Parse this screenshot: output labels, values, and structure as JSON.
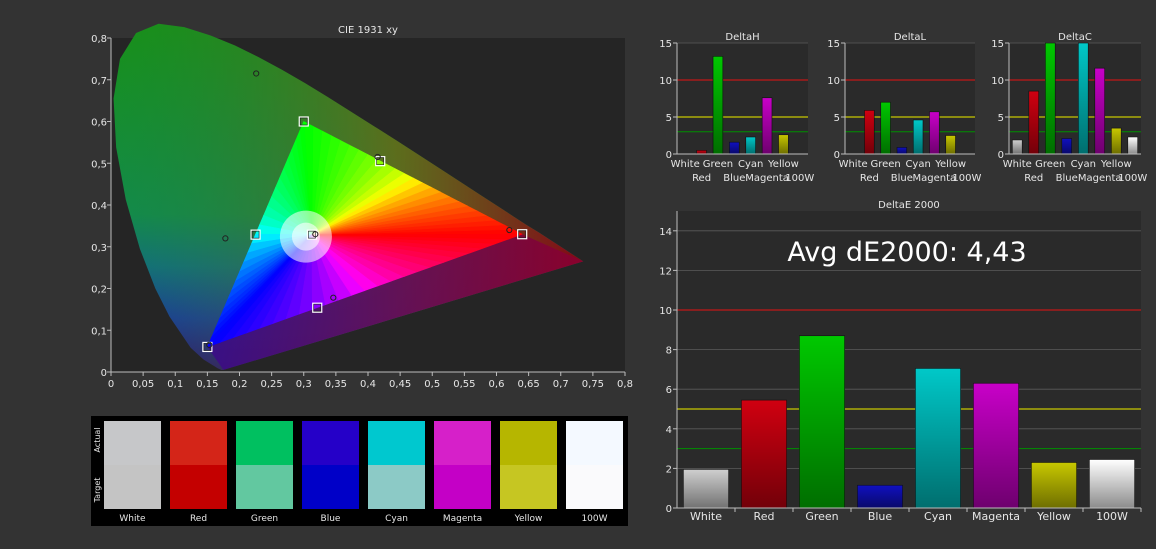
{
  "chart_data": [
    {
      "type": "scatter",
      "title": "CIE 1931 xy",
      "xlim": [
        0,
        0.8
      ],
      "ylim": [
        0,
        0.8
      ],
      "x_ticks": [
        "0",
        "0,05",
        "0,1",
        "0,15",
        "0,2",
        "0,25",
        "0,3",
        "0,35",
        "0,4",
        "0,45",
        "0,5",
        "0,55",
        "0,6",
        "0,65",
        "0,7",
        "0,75",
        "0,8"
      ],
      "y_ticks": [
        "0",
        "0,1",
        "0,2",
        "0,3",
        "0,4",
        "0,5",
        "0,6",
        "0,7",
        "0,8"
      ],
      "series": [
        {
          "values": [
            [
              0.64,
              0.33
            ],
            [
              0.3,
              0.6
            ],
            [
              0.15,
              0.06
            ],
            [
              0.225,
              0.329
            ],
            [
              0.321,
              0.154
            ],
            [
              0.419,
              0.505
            ],
            [
              0.3127,
              0.329
            ]
          ]
        },
        {
          "values": [
            [
              0.62,
              0.34
            ],
            [
              0.226,
              0.715
            ],
            [
              0.153,
              0.065
            ],
            [
              0.178,
              0.32
            ],
            [
              0.346,
              0.178
            ],
            [
              0.415,
              0.515
            ],
            [
              0.318,
              0.33
            ]
          ]
        }
      ]
    },
    {
      "type": "bar",
      "title": "DeltaH",
      "categories": [
        "White",
        "Red",
        "Green",
        "Blue",
        "Cyan",
        "Magenta",
        "Yellow",
        "100W"
      ],
      "values": [
        0,
        0.5,
        13.2,
        1.6,
        2.3,
        7.6,
        2.6,
        0
      ],
      "ylim": [
        0,
        15
      ],
      "y_ticks": [
        "0",
        "5",
        "10",
        "15"
      ]
    },
    {
      "type": "bar",
      "title": "DeltaL",
      "categories": [
        "White",
        "Red",
        "Green",
        "Blue",
        "Cyan",
        "Magenta",
        "Yellow",
        "100W"
      ],
      "values": [
        0,
        5.9,
        7.0,
        0.9,
        4.6,
        5.7,
        2.5,
        0
      ],
      "ylim": [
        0,
        15
      ],
      "y_ticks": [
        "0",
        "5",
        "10",
        "15"
      ]
    },
    {
      "type": "bar",
      "title": "DeltaC",
      "categories": [
        "White",
        "Red",
        "Green",
        "Blue",
        "Cyan",
        "Magenta",
        "Yellow",
        "100W"
      ],
      "values": [
        1.9,
        8.5,
        15,
        2.1,
        15,
        11.6,
        3.5,
        2.3
      ],
      "ylim": [
        0,
        15
      ],
      "y_ticks": [
        "0",
        "5",
        "10",
        "15"
      ]
    },
    {
      "type": "bar",
      "title": "DeltaE 2000",
      "annotation": "Avg dE2000: 4,43",
      "categories": [
        "White",
        "Red",
        "Green",
        "Blue",
        "Cyan",
        "Magenta",
        "Yellow",
        "100W"
      ],
      "values": [
        1.95,
        5.45,
        8.7,
        1.15,
        7.05,
        6.3,
        2.3,
        2.45
      ],
      "ylim": [
        0,
        15
      ],
      "y_ticks": [
        "0",
        "2",
        "4",
        "6",
        "8",
        "10",
        "12",
        "14"
      ]
    }
  ],
  "swatches": {
    "side_labels": [
      "Actual",
      "Target"
    ],
    "items": [
      {
        "label": "White",
        "actual": "#c6c7c9",
        "target": "#c4c4c4"
      },
      {
        "label": "Red",
        "actual": "#d42518",
        "target": "#c40000"
      },
      {
        "label": "Green",
        "actual": "#00c060",
        "target": "#62c8a0"
      },
      {
        "label": "Blue",
        "actual": "#2500c8",
        "target": "#0000c8"
      },
      {
        "label": "Cyan",
        "actual": "#00c8cf",
        "target": "#8ccac6"
      },
      {
        "label": "Magenta",
        "actual": "#d620c9",
        "target": "#c400c6"
      },
      {
        "label": "Yellow",
        "actual": "#b6b600",
        "target": "#c6c622"
      },
      {
        "label": "100W",
        "actual": "#f4f9ff",
        "target": "#fafafc"
      }
    ]
  },
  "colors": {
    "White": "#cfcfcf",
    "Red": "#d00010",
    "Green": "#00c800",
    "Blue": "#1010c0",
    "Cyan": "#00c8c8",
    "Magenta": "#c800c8",
    "Yellow": "#c8c800",
    "100W": "#ffffff",
    "red_threshold": "#c01818",
    "yellow_threshold": "#c8c800",
    "green_threshold": "#009000"
  },
  "thresholds": {
    "small": [
      10,
      5,
      3
    ],
    "de": [
      10,
      5,
      3
    ]
  }
}
